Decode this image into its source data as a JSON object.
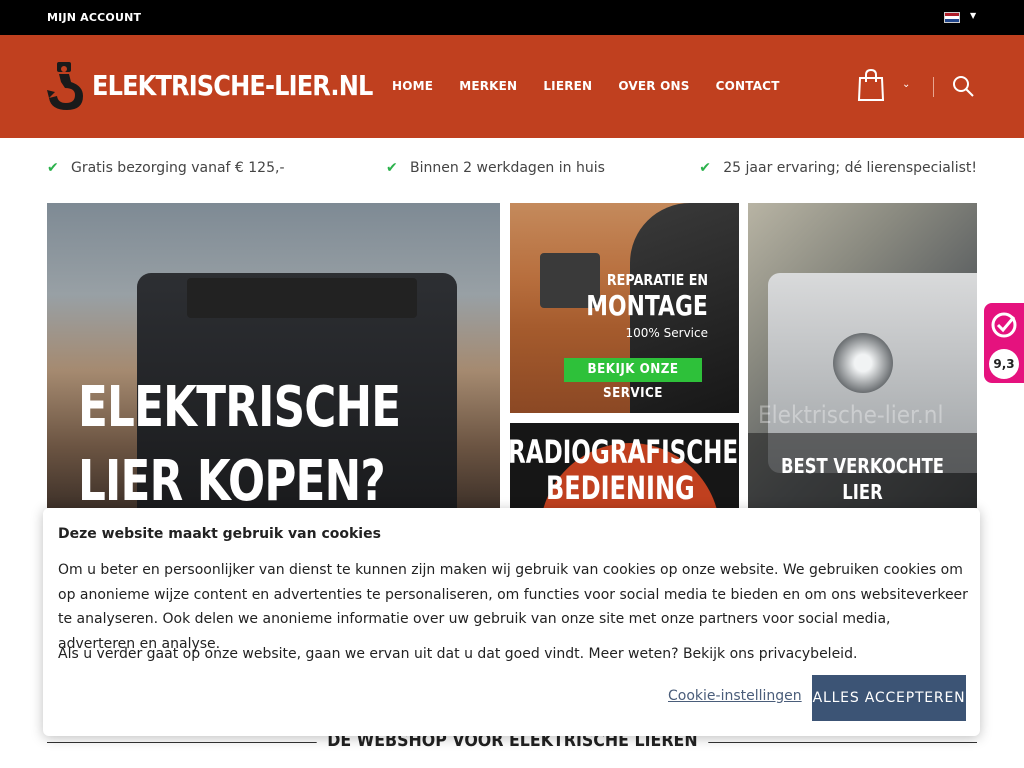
{
  "topbar": {
    "account_label": "MIJN ACCOUNT",
    "language_flag": "netherlands-flag",
    "caret_icon": "caret-down-icon"
  },
  "header": {
    "logo_text": "ELEKTRISCHE-LIER.NL",
    "logo_icon": "winch-hook-icon",
    "nav": [
      "HOME",
      "MERKEN",
      "LIEREN",
      "OVER ONS",
      "CONTACT"
    ],
    "cart_icon": "shopping-bag-icon",
    "search_icon": "search-icon",
    "brand_color": "#c0401f"
  },
  "usps": [
    "Gratis bezorging vanaf € 125,-",
    "Binnen 2 werkdagen in huis",
    "25 jaar ervaring; dé lierenspecialist!"
  ],
  "hero": {
    "title_line1": "ELEKTRISCHE",
    "title_line2": "LIER KOPEN?"
  },
  "tile_service": {
    "title_line1": "REPARATIE EN",
    "title_line2": "MONTAGE",
    "subtitle": "100% Service",
    "button_label": "BEKIJK ONZE SERVICE",
    "button_color": "#2ec13a"
  },
  "tile_radio": {
    "title_line1": "RADIOGRAFISCHE",
    "title_line2": "BEDIENING"
  },
  "tile_best": {
    "watermark": "Elektrische-lier.nl",
    "title_line1": "BEST VERKOCHTE",
    "title_line2": "LIER"
  },
  "review_badge": {
    "score": "9,3",
    "color": "#e5127e"
  },
  "cookie": {
    "title": "Deze website maakt gebruik van cookies",
    "paragraph1": "Om u beter en persoonlijker van dienst te kunnen zijn maken wij gebruik van cookies op onze website. We gebruiken cookies om op anonieme wijze content en advertenties te personaliseren, om functies voor social media te bieden en om ons websiteverkeer te analyseren. Ook delen we anonieme informatie over uw gebruik van onze site met onze partners voor social media, adverteren en analyse.",
    "paragraph2": "Als u verder gaat op onze website, gaan we ervan uit dat u dat goed vindt. Meer weten? Bekijk ons privacybeleid.",
    "settings_label": "Cookie-instellingen",
    "accept_label": "ALLES ACCEPTEREN",
    "accept_color": "#3c5475"
  },
  "section": {
    "title": "DE WEBSHOP VOOR ELEKTRISCHE LIEREN"
  }
}
